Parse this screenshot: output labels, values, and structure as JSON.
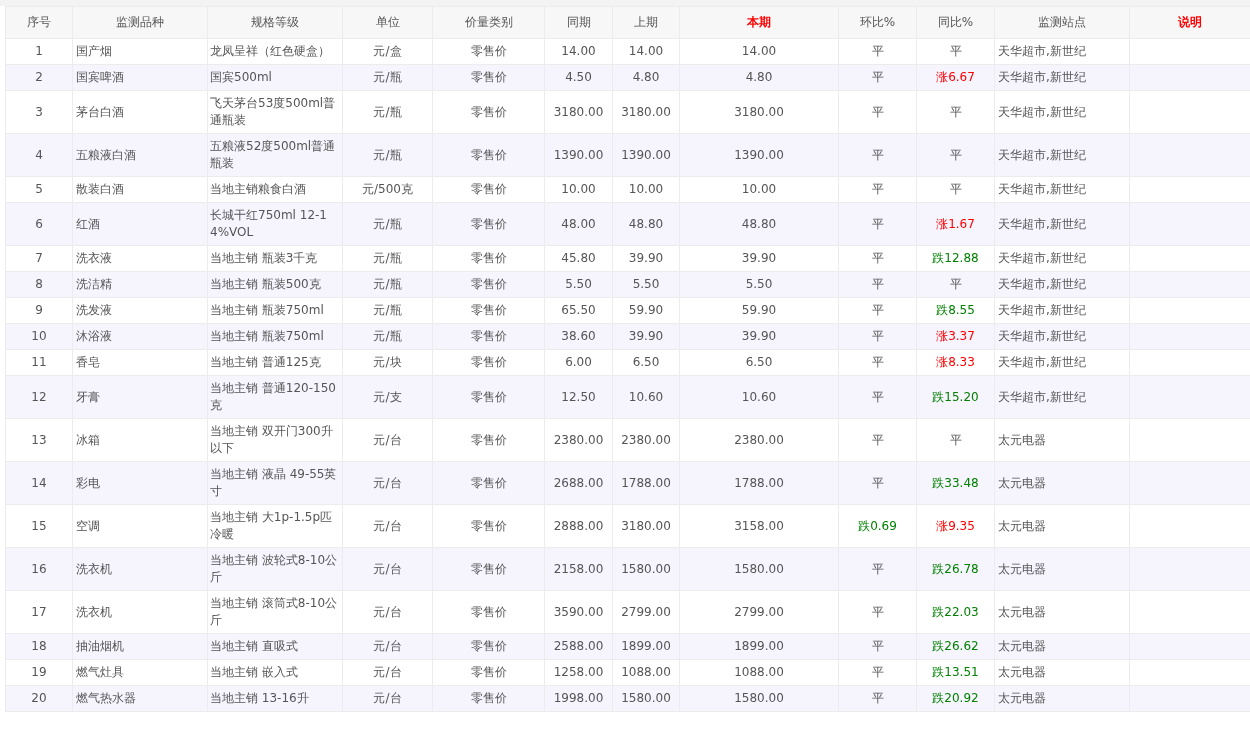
{
  "columns": [
    {
      "label": "序号",
      "highlighted": false
    },
    {
      "label": "监测品种",
      "highlighted": false
    },
    {
      "label": "规格等级",
      "highlighted": false
    },
    {
      "label": "单位",
      "highlighted": false
    },
    {
      "label": "价量类别",
      "highlighted": false
    },
    {
      "label": "同期",
      "highlighted": false
    },
    {
      "label": "上期",
      "highlighted": false
    },
    {
      "label": "本期",
      "highlighted": true
    },
    {
      "label": "环比%",
      "highlighted": false
    },
    {
      "label": "同比%",
      "highlighted": false
    },
    {
      "label": "监测站点",
      "highlighted": false
    },
    {
      "label": "说明",
      "highlighted": true
    }
  ],
  "rows": [
    {
      "no": "1",
      "item": "国产烟",
      "spec": "龙凤呈祥（红色硬盒）",
      "unit": "元/盒",
      "type": "零售价",
      "same": "14.00",
      "prev": "14.00",
      "cur": "14.00",
      "mom": {
        "text": "平",
        "kind": "flat"
      },
      "yoy": {
        "text": "平",
        "kind": "flat"
      },
      "site": "天华超市,新世纪"
    },
    {
      "no": "2",
      "item": "国宾啤酒",
      "spec": "国宾500ml",
      "unit": "元/瓶",
      "type": "零售价",
      "same": "4.50",
      "prev": "4.80",
      "cur": "4.80",
      "mom": {
        "text": "平",
        "kind": "flat"
      },
      "yoy": {
        "text": "涨6.67",
        "kind": "up"
      },
      "site": "天华超市,新世纪"
    },
    {
      "no": "3",
      "item": "茅台白酒",
      "spec": "飞天茅台53度500ml普通瓶装",
      "unit": "元/瓶",
      "type": "零售价",
      "same": "3180.00",
      "prev": "3180.00",
      "cur": "3180.00",
      "mom": {
        "text": "平",
        "kind": "flat"
      },
      "yoy": {
        "text": "平",
        "kind": "flat"
      },
      "site": "天华超市,新世纪"
    },
    {
      "no": "4",
      "item": "五粮液白酒",
      "spec": "五粮液52度500ml普通瓶装",
      "unit": "元/瓶",
      "type": "零售价",
      "same": "1390.00",
      "prev": "1390.00",
      "cur": "1390.00",
      "mom": {
        "text": "平",
        "kind": "flat"
      },
      "yoy": {
        "text": "平",
        "kind": "flat"
      },
      "site": "天华超市,新世纪"
    },
    {
      "no": "5",
      "item": "散装白酒",
      "spec": "当地主销粮食白酒",
      "unit": "元/500克",
      "type": "零售价",
      "same": "10.00",
      "prev": "10.00",
      "cur": "10.00",
      "mom": {
        "text": "平",
        "kind": "flat"
      },
      "yoy": {
        "text": "平",
        "kind": "flat"
      },
      "site": "天华超市,新世纪"
    },
    {
      "no": "6",
      "item": "红酒",
      "spec": "长城干红750ml 12-14%VOL",
      "unit": "元/瓶",
      "type": "零售价",
      "same": "48.00",
      "prev": "48.80",
      "cur": "48.80",
      "mom": {
        "text": "平",
        "kind": "flat"
      },
      "yoy": {
        "text": "涨1.67",
        "kind": "up"
      },
      "site": "天华超市,新世纪"
    },
    {
      "no": "7",
      "item": "洗衣液",
      "spec": "当地主销 瓶装3千克",
      "unit": "元/瓶",
      "type": "零售价",
      "same": "45.80",
      "prev": "39.90",
      "cur": "39.90",
      "mom": {
        "text": "平",
        "kind": "flat"
      },
      "yoy": {
        "text": "跌12.88",
        "kind": "down"
      },
      "site": "天华超市,新世纪"
    },
    {
      "no": "8",
      "item": "洗洁精",
      "spec": "当地主销 瓶装500克",
      "unit": "元/瓶",
      "type": "零售价",
      "same": "5.50",
      "prev": "5.50",
      "cur": "5.50",
      "mom": {
        "text": "平",
        "kind": "flat"
      },
      "yoy": {
        "text": "平",
        "kind": "flat"
      },
      "site": "天华超市,新世纪"
    },
    {
      "no": "9",
      "item": "洗发液",
      "spec": "当地主销 瓶装750ml",
      "unit": "元/瓶",
      "type": "零售价",
      "same": "65.50",
      "prev": "59.90",
      "cur": "59.90",
      "mom": {
        "text": "平",
        "kind": "flat"
      },
      "yoy": {
        "text": "跌8.55",
        "kind": "down"
      },
      "site": "天华超市,新世纪"
    },
    {
      "no": "10",
      "item": "沐浴液",
      "spec": "当地主销 瓶装750ml",
      "unit": "元/瓶",
      "type": "零售价",
      "same": "38.60",
      "prev": "39.90",
      "cur": "39.90",
      "mom": {
        "text": "平",
        "kind": "flat"
      },
      "yoy": {
        "text": "涨3.37",
        "kind": "up"
      },
      "site": "天华超市,新世纪"
    },
    {
      "no": "11",
      "item": "香皂",
      "spec": "当地主销 普通125克",
      "unit": "元/块",
      "type": "零售价",
      "same": "6.00",
      "prev": "6.50",
      "cur": "6.50",
      "mom": {
        "text": "平",
        "kind": "flat"
      },
      "yoy": {
        "text": "涨8.33",
        "kind": "up"
      },
      "site": "天华超市,新世纪"
    },
    {
      "no": "12",
      "item": "牙膏",
      "spec": "当地主销 普通120-150克",
      "unit": "元/支",
      "type": "零售价",
      "same": "12.50",
      "prev": "10.60",
      "cur": "10.60",
      "mom": {
        "text": "平",
        "kind": "flat"
      },
      "yoy": {
        "text": "跌15.20",
        "kind": "down"
      },
      "site": "天华超市,新世纪"
    },
    {
      "no": "13",
      "item": "冰箱",
      "spec": "当地主销 双开门300升以下",
      "unit": "元/台",
      "type": "零售价",
      "same": "2380.00",
      "prev": "2380.00",
      "cur": "2380.00",
      "mom": {
        "text": "平",
        "kind": "flat"
      },
      "yoy": {
        "text": "平",
        "kind": "flat"
      },
      "site": "太元电器"
    },
    {
      "no": "14",
      "item": "彩电",
      "spec": "当地主销 液晶 49-55英寸",
      "unit": "元/台",
      "type": "零售价",
      "same": "2688.00",
      "prev": "1788.00",
      "cur": "1788.00",
      "mom": {
        "text": "平",
        "kind": "flat"
      },
      "yoy": {
        "text": "跌33.48",
        "kind": "down"
      },
      "site": "太元电器"
    },
    {
      "no": "15",
      "item": "空调",
      "spec": "当地主销 大1p-1.5p匹冷暖",
      "unit": "元/台",
      "type": "零售价",
      "same": "2888.00",
      "prev": "3180.00",
      "cur": "3158.00",
      "mom": {
        "text": "跌0.69",
        "kind": "down"
      },
      "yoy": {
        "text": "涨9.35",
        "kind": "up"
      },
      "site": "太元电器"
    },
    {
      "no": "16",
      "item": "洗衣机",
      "spec": "当地主销 波轮式8-10公斤",
      "unit": "元/台",
      "type": "零售价",
      "same": "2158.00",
      "prev": "1580.00",
      "cur": "1580.00",
      "mom": {
        "text": "平",
        "kind": "flat"
      },
      "yoy": {
        "text": "跌26.78",
        "kind": "down"
      },
      "site": "太元电器"
    },
    {
      "no": "17",
      "item": "洗衣机",
      "spec": "当地主销 滚筒式8-10公斤",
      "unit": "元/台",
      "type": "零售价",
      "same": "3590.00",
      "prev": "2799.00",
      "cur": "2799.00",
      "mom": {
        "text": "平",
        "kind": "flat"
      },
      "yoy": {
        "text": "跌22.03",
        "kind": "down"
      },
      "site": "太元电器"
    },
    {
      "no": "18",
      "item": "抽油烟机",
      "spec": "当地主销 直吸式",
      "unit": "元/台",
      "type": "零售价",
      "same": "2588.00",
      "prev": "1899.00",
      "cur": "1899.00",
      "mom": {
        "text": "平",
        "kind": "flat"
      },
      "yoy": {
        "text": "跌26.62",
        "kind": "down"
      },
      "site": "太元电器"
    },
    {
      "no": "19",
      "item": "燃气灶具",
      "spec": "当地主销 嵌入式",
      "unit": "元/台",
      "type": "零售价",
      "same": "1258.00",
      "prev": "1088.00",
      "cur": "1088.00",
      "mom": {
        "text": "平",
        "kind": "flat"
      },
      "yoy": {
        "text": "跌13.51",
        "kind": "down"
      },
      "site": "太元电器"
    },
    {
      "no": "20",
      "item": "燃气热水器",
      "spec": "当地主销 13-16升",
      "unit": "元/台",
      "type": "零售价",
      "same": "1998.00",
      "prev": "1580.00",
      "cur": "1580.00",
      "mom": {
        "text": "平",
        "kind": "flat"
      },
      "yoy": {
        "text": "跌20.92",
        "kind": "down"
      },
      "site": "太元电器"
    }
  ]
}
